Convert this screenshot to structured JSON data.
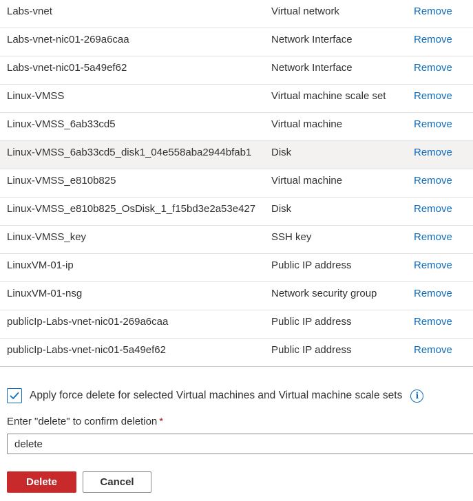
{
  "resources": [
    {
      "name": "Labs-vnet",
      "type": "Virtual network",
      "action": "Remove"
    },
    {
      "name": "Labs-vnet-nic01-269a6caa",
      "type": "Network Interface",
      "action": "Remove"
    },
    {
      "name": "Labs-vnet-nic01-5a49ef62",
      "type": "Network Interface",
      "action": "Remove"
    },
    {
      "name": "Linux-VMSS",
      "type": "Virtual machine scale set",
      "action": "Remove"
    },
    {
      "name": "Linux-VMSS_6ab33cd5",
      "type": "Virtual machine",
      "action": "Remove"
    },
    {
      "name": "Linux-VMSS_6ab33cd5_disk1_04e558aba2944bfab1",
      "type": "Disk",
      "action": "Remove"
    },
    {
      "name": "Linux-VMSS_e810b825",
      "type": "Virtual machine",
      "action": "Remove"
    },
    {
      "name": "Linux-VMSS_e810b825_OsDisk_1_f15bd3e2a53e427",
      "type": "Disk",
      "action": "Remove"
    },
    {
      "name": "Linux-VMSS_key",
      "type": "SSH key",
      "action": "Remove"
    },
    {
      "name": "LinuxVM-01-ip",
      "type": "Public IP address",
      "action": "Remove"
    },
    {
      "name": "LinuxVM-01-nsg",
      "type": "Network security group",
      "action": "Remove"
    },
    {
      "name": "publicIp-Labs-vnet-nic01-269a6caa",
      "type": "Public IP address",
      "action": "Remove"
    },
    {
      "name": "publicIp-Labs-vnet-nic01-5a49ef62",
      "type": "Public IP address",
      "action": "Remove"
    }
  ],
  "highlighted_row": 5,
  "force_delete": {
    "checked": true,
    "label": "Apply force delete for selected Virtual machines and Virtual machine scale sets",
    "info_icon": "info-icon"
  },
  "confirm": {
    "label": "Enter \"delete\" to confirm deletion",
    "required_mark": "*",
    "value": "delete"
  },
  "buttons": {
    "delete_label": "Delete",
    "cancel_label": "Cancel"
  },
  "colors": {
    "link": "#0f6cbd",
    "delete_button": "#c82a2c",
    "required": "#a4262c"
  }
}
